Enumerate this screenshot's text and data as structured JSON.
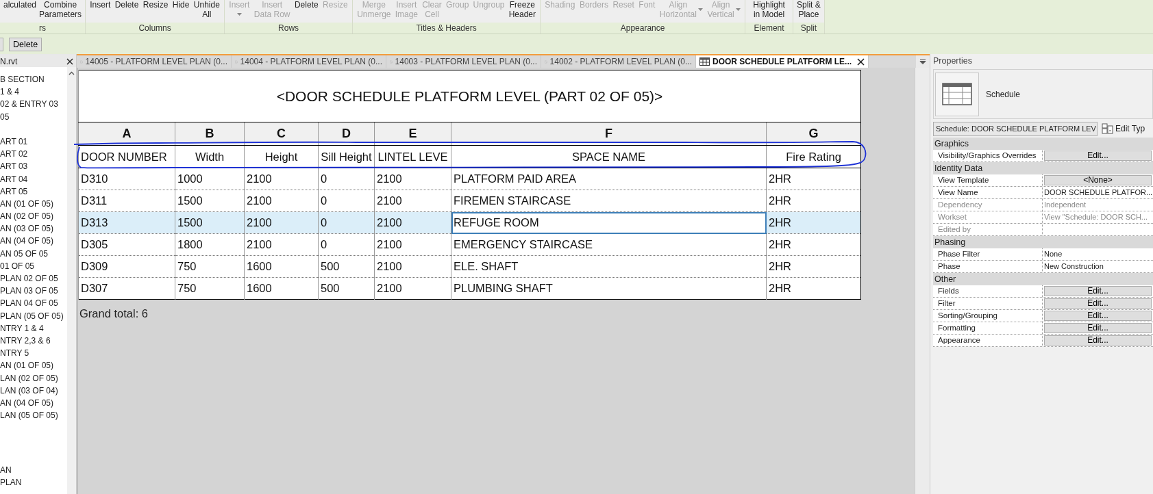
{
  "ribbon": {
    "groups": [
      {
        "label": "rs",
        "buttons": [
          {
            "label": "alculated",
            "disabled": false
          },
          {
            "label": "Combine\nParameters",
            "disabled": false
          }
        ]
      },
      {
        "label": "Columns",
        "buttons": [
          {
            "label": "Insert",
            "disabled": false
          },
          {
            "label": "Delete",
            "disabled": false
          },
          {
            "label": "Resize",
            "disabled": false
          },
          {
            "label": "Hide",
            "disabled": false
          },
          {
            "label": "Unhide\nAll",
            "disabled": false
          }
        ]
      },
      {
        "label": "Rows",
        "buttons": [
          {
            "label": "Insert",
            "disabled": true,
            "dropdown": true
          },
          {
            "label": "Insert\nData Row",
            "disabled": true
          },
          {
            "label": "Delete",
            "disabled": false
          },
          {
            "label": "Resize",
            "disabled": true
          }
        ]
      },
      {
        "label": "Titles & Headers",
        "buttons": [
          {
            "label": "Merge\nUnmerge",
            "disabled": true
          },
          {
            "label": "Insert\nImage",
            "disabled": true
          },
          {
            "label": "Clear\nCell",
            "disabled": true
          },
          {
            "label": "Group",
            "disabled": true
          },
          {
            "label": "Ungroup",
            "disabled": true
          },
          {
            "label": "Freeze\nHeader",
            "disabled": false
          }
        ]
      },
      {
        "label": "Appearance",
        "buttons": [
          {
            "label": "Shading",
            "disabled": true
          },
          {
            "label": "Borders",
            "disabled": true
          },
          {
            "label": "Reset",
            "disabled": true
          },
          {
            "label": "Font",
            "disabled": true
          },
          {
            "label": "Align\nHorizontal",
            "disabled": true,
            "dropdown": true
          },
          {
            "label": "Align\nVertical",
            "disabled": true,
            "dropdown": true
          }
        ]
      },
      {
        "label": "Element",
        "buttons": [
          {
            "label": "Highlight\nin Model",
            "disabled": false
          }
        ]
      },
      {
        "label": "Split",
        "buttons": [
          {
            "label": "Split &\nPlace",
            "disabled": false
          }
        ]
      }
    ]
  },
  "options_bar": {
    "buttons": [
      "Delete"
    ]
  },
  "browser": {
    "title": "N.rvt",
    "groups": [
      [
        "B SECTION",
        "1 & 4",
        "02 & ENTRY 03",
        "05"
      ],
      [
        "ART 01",
        "ART 02",
        "ART 03",
        "ART 04",
        "ART 05",
        "AN (01 OF 05)",
        "AN (02 OF 05)",
        "AN (03 OF 05)",
        "AN (04 OF 05)",
        "AN 05 OF 05",
        "01 OF 05",
        "PLAN 02 OF 05",
        "PLAN 03 OF 05",
        "PLAN 04 OF 05",
        "PLAN (05 OF 05)",
        "NTRY 1 & 4",
        "NTRY 2,3 & 6",
        "NTRY 5",
        "AN (01 OF 05)",
        "LAN (02 OF 05)",
        "LAN (03 OF 04)",
        "AN (04 OF 05)",
        "LAN (05 OF 05)"
      ],
      [
        "AN",
        "PLAN"
      ]
    ]
  },
  "tabs": [
    {
      "label": "14005 - PLATFORM LEVEL PLAN (0...",
      "kind": "plan",
      "selected": false
    },
    {
      "label": "14004 - PLATFORM LEVEL PLAN (0...",
      "kind": "plan",
      "selected": false
    },
    {
      "label": "14003 - PLATFORM LEVEL PLAN (0...",
      "kind": "plan",
      "selected": false
    },
    {
      "label": "14002 - PLATFORM LEVEL PLAN (0...",
      "kind": "plan",
      "selected": false
    },
    {
      "label": "DOOR SCHEDULE PLATFORM LE...",
      "kind": "schedule",
      "selected": true
    }
  ],
  "schedule": {
    "title": "<DOOR SCHEDULE PLATFORM LEVEL (PART 02 OF 05)>",
    "columns": [
      {
        "letter": "A",
        "header": "DOOR NUMBER"
      },
      {
        "letter": "B",
        "header": "Width"
      },
      {
        "letter": "C",
        "header": "Height"
      },
      {
        "letter": "D",
        "header": "Sill Height"
      },
      {
        "letter": "E",
        "header": "LINTEL LEVE"
      },
      {
        "letter": "F",
        "header": "SPACE NAME"
      },
      {
        "letter": "G",
        "header": "Fire Rating"
      }
    ],
    "rows": [
      {
        "selected": false,
        "cells": [
          {
            "text": "D310",
            "focused": false
          },
          {
            "text": "1000",
            "focused": false
          },
          {
            "text": "2100",
            "focused": false
          },
          {
            "text": "0",
            "focused": false
          },
          {
            "text": "2100",
            "focused": false
          },
          {
            "text": "PLATFORM PAID AREA",
            "focused": false
          },
          {
            "text": "2HR",
            "focused": false
          }
        ]
      },
      {
        "selected": false,
        "cells": [
          {
            "text": "D311",
            "focused": false
          },
          {
            "text": "1500",
            "focused": false
          },
          {
            "text": "2100",
            "focused": false
          },
          {
            "text": "0",
            "focused": false
          },
          {
            "text": "2100",
            "focused": false
          },
          {
            "text": "FIREMEN STAIRCASE",
            "focused": false
          },
          {
            "text": "2HR",
            "focused": false
          }
        ]
      },
      {
        "selected": true,
        "cells": [
          {
            "text": "D313",
            "focused": false
          },
          {
            "text": "1500",
            "focused": false
          },
          {
            "text": "2100",
            "focused": false
          },
          {
            "text": "0",
            "focused": false
          },
          {
            "text": "2100",
            "focused": false
          },
          {
            "text": "REFUGE ROOM",
            "focused": true
          },
          {
            "text": "2HR",
            "focused": false
          }
        ]
      },
      {
        "selected": false,
        "cells": [
          {
            "text": "D305",
            "focused": false
          },
          {
            "text": "1800",
            "focused": false
          },
          {
            "text": "2100",
            "focused": false
          },
          {
            "text": "0",
            "focused": false
          },
          {
            "text": "2100",
            "focused": false
          },
          {
            "text": "EMERGENCY STAIRCASE",
            "focused": false
          },
          {
            "text": "2HR",
            "focused": false
          }
        ]
      },
      {
        "selected": false,
        "cells": [
          {
            "text": "D309",
            "focused": false
          },
          {
            "text": "750",
            "focused": false
          },
          {
            "text": "1600",
            "focused": false
          },
          {
            "text": "500",
            "focused": false
          },
          {
            "text": "2100",
            "focused": false
          },
          {
            "text": "ELE. SHAFT",
            "focused": false
          },
          {
            "text": "2HR",
            "focused": false
          }
        ]
      },
      {
        "selected": false,
        "cells": [
          {
            "text": "D307",
            "focused": false
          },
          {
            "text": "750",
            "focused": false
          },
          {
            "text": "1600",
            "focused": false
          },
          {
            "text": "500",
            "focused": false
          },
          {
            "text": "2100",
            "focused": false
          },
          {
            "text": "PLUMBING SHAFT",
            "focused": false
          },
          {
            "text": "2HR",
            "focused": false
          }
        ]
      }
    ],
    "grand_total": "Grand total: 6"
  },
  "properties": {
    "title": "Properties",
    "type_name": "Schedule",
    "type_selector": "Schedule: DOOR SCHEDULE PLATFORM LEV",
    "edit_type": "Edit Typ",
    "sections": [
      {
        "name": "Graphics",
        "rows": [
          {
            "label": "Visibility/Graphics Overrides",
            "value": "Edit...",
            "kind": "button",
            "disabled": false
          }
        ]
      },
      {
        "name": "Identity Data",
        "rows": [
          {
            "label": "View Template",
            "value": "<None>",
            "kind": "button",
            "disabled": false
          },
          {
            "label": "View Name",
            "value": "DOOR SCHEDULE PLATFOR...",
            "kind": "text",
            "disabled": false
          },
          {
            "label": "Dependency",
            "value": "Independent",
            "kind": "text",
            "disabled": true
          },
          {
            "label": "Workset",
            "value": "View \"Schedule: DOOR SCH...",
            "kind": "text",
            "disabled": true
          },
          {
            "label": "Edited by",
            "kind": "text",
            "disabled": true
          }
        ]
      },
      {
        "name": "Phasing",
        "rows": [
          {
            "label": "Phase Filter",
            "value": "None",
            "kind": "text",
            "disabled": false
          },
          {
            "label": "Phase",
            "value": "New Construction",
            "kind": "text",
            "disabled": false
          }
        ]
      },
      {
        "name": "Other",
        "rows": [
          {
            "label": "Fields",
            "value": "Edit...",
            "kind": "button",
            "disabled": false
          },
          {
            "label": "Filter",
            "value": "Edit...",
            "kind": "button",
            "disabled": false
          },
          {
            "label": "Sorting/Grouping",
            "value": "Edit...",
            "kind": "button",
            "disabled": false
          },
          {
            "label": "Formatting",
            "value": "Edit...",
            "kind": "button",
            "disabled": false
          },
          {
            "label": "Appearance",
            "value": "Edit...",
            "kind": "button",
            "disabled": false
          }
        ]
      }
    ]
  }
}
